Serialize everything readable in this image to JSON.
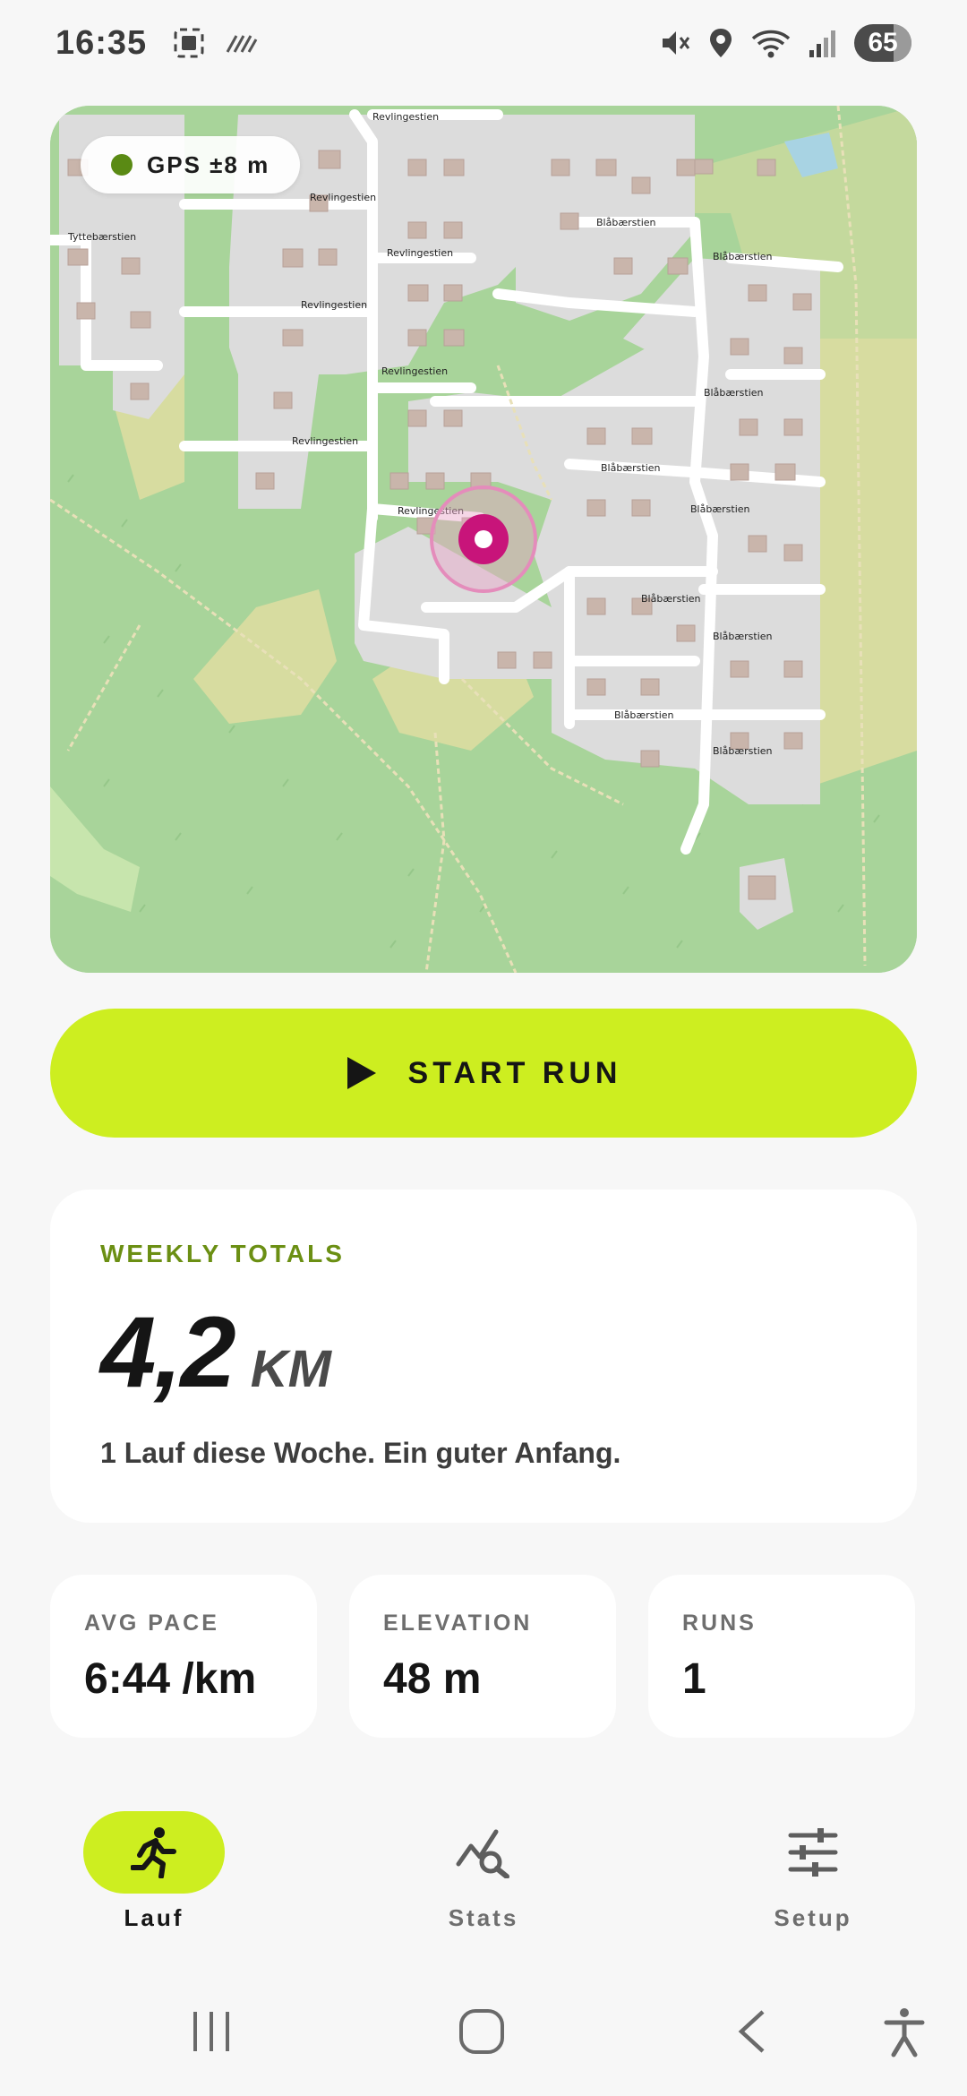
{
  "status_bar": {
    "time": "16:35",
    "battery": "65",
    "icons": [
      "gallery-icon",
      "hatch-icon",
      "mute-icon",
      "location-icon",
      "wifi-icon",
      "signal-icon",
      "battery-icon"
    ]
  },
  "map": {
    "gps_status": "GPS ±8 m",
    "gps_dot_color": "#5a8a14",
    "location_marker_color": "#c8147a",
    "street_labels": {
      "revlingestien": "Revlingestien",
      "blabaerstien": "Blåbærstien",
      "tyttebaerstien": "Tyttebærstien"
    }
  },
  "start_button": {
    "label": "START RUN",
    "color": "#cdee20"
  },
  "weekly": {
    "eyebrow": "WEEKLY TOTALS",
    "value": "4,2",
    "unit": "KM",
    "note": "1 Lauf diese Woche. Ein guter Anfang."
  },
  "metrics": [
    {
      "label": "AVG PACE",
      "value": "6:44 /km"
    },
    {
      "label": "ELEVATION",
      "value": "48 m"
    },
    {
      "label": "RUNS",
      "value": "1"
    }
  ],
  "nav": {
    "items": [
      {
        "label": "Lauf",
        "icon": "runner-icon",
        "active": true
      },
      {
        "label": "Stats",
        "icon": "stats-search-icon",
        "active": false
      },
      {
        "label": "Setup",
        "icon": "sliders-icon",
        "active": false
      }
    ]
  },
  "system_nav": [
    "recents-icon",
    "home-icon",
    "back-icon",
    "accessibility-icon"
  ]
}
